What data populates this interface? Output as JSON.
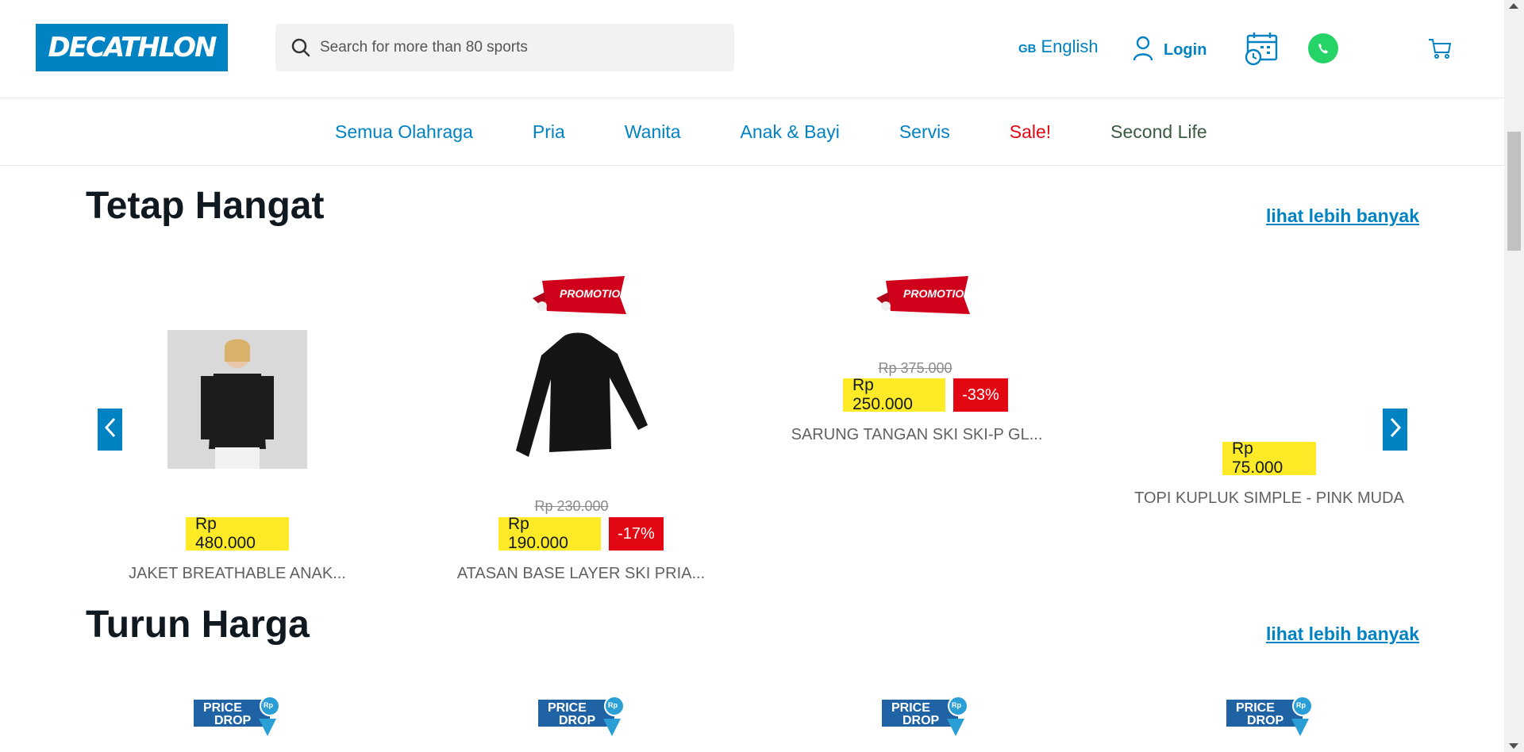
{
  "header": {
    "logo_text": "DECATHLON",
    "search_placeholder": "Search for more than 80 sports",
    "lang_code": "GB",
    "lang_label": "English",
    "login_label": "Login",
    "icons": [
      "search-icon",
      "user-icon",
      "calendar-icon",
      "whatsapp-icon",
      "cart-icon"
    ]
  },
  "nav": {
    "items": [
      "Semua Olahraga",
      "Pria",
      "Wanita",
      "Anak & Bayi",
      "Servis",
      "Sale!",
      "Second Life"
    ]
  },
  "sections": [
    {
      "title": "Tetap Hangat",
      "more_label": "lihat lebih banyak",
      "products": [
        {
          "name": "JAKET BREATHABLE ANAK...",
          "price": "Rp 480.000",
          "old_price": "",
          "discount": "",
          "promotion": ""
        },
        {
          "name": "ATASAN BASE LAYER SKI PRIA...",
          "price": "Rp 190.000",
          "old_price": "Rp 230.000",
          "discount": "-17%",
          "promotion": "PROMOTION"
        },
        {
          "name": "SARUNG TANGAN SKI SKI-P GL...",
          "price": "Rp 250.000",
          "old_price": "Rp 375.000",
          "discount": "-33%",
          "promotion": "PROMOTION"
        },
        {
          "name": "TOPI KUPLUK SIMPLE - PINK MUDA",
          "price": "Rp 75.000",
          "old_price": "",
          "discount": "",
          "promotion": ""
        }
      ]
    },
    {
      "title": "Turun Harga",
      "more_label": "lihat lebih banyak",
      "badge_label_1": "PRICE",
      "badge_label_2": "DROP",
      "badge_symbol": "Rp"
    }
  ],
  "colors": {
    "brand": "#0082c3",
    "price_bg": "#ffea28",
    "discount_bg": "#e30613",
    "sale": "#e30613"
  }
}
